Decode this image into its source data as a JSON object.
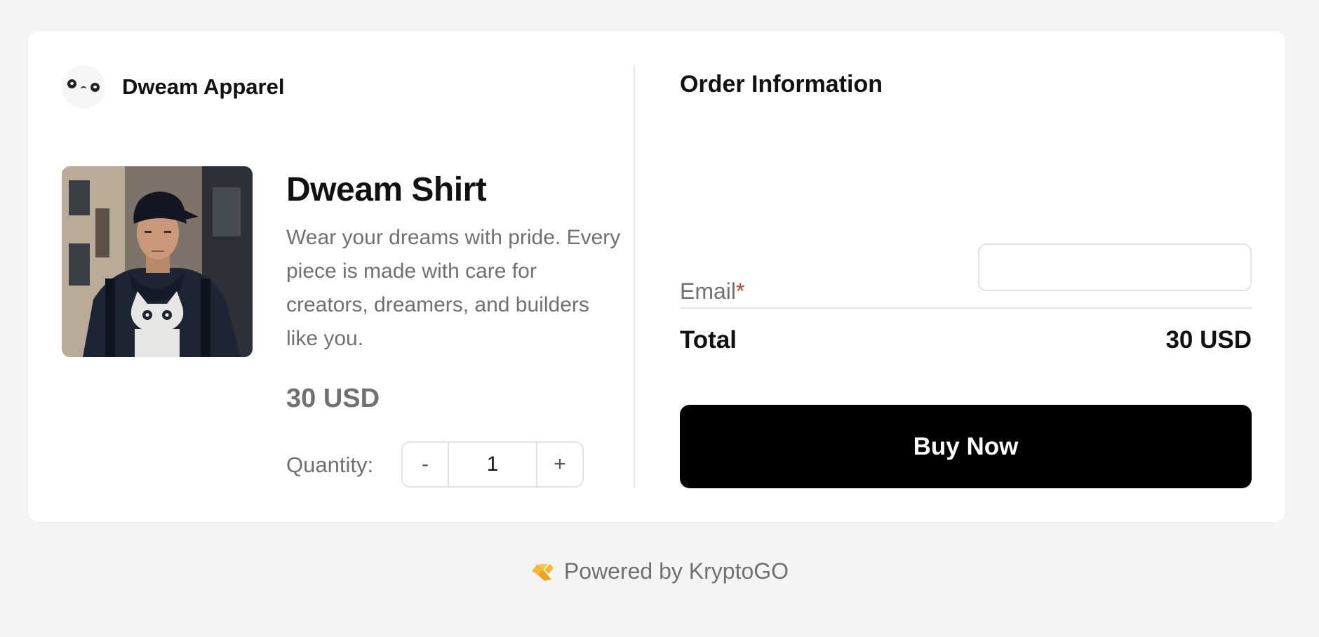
{
  "brand": {
    "name": "Dweam Apparel",
    "logo_icon": "panda-face-icon"
  },
  "product": {
    "title": "Dweam Shirt",
    "description": "Wear your dreams with pride. Every piece is made with care for creators, dreamers, and builders like you.",
    "price": "30 USD",
    "image_icon": "product-photo-icon",
    "quantity_label": "Quantity:",
    "decrement_label": "-",
    "increment_label": "+",
    "quantity_value": "1"
  },
  "order": {
    "title": "Order Information",
    "email_label": "Email",
    "email_required_mark": "*",
    "email_value": "",
    "total_label": "Total",
    "total_value": "30 USD",
    "buy_label": "Buy Now"
  },
  "footer": {
    "powered_by": "Powered by KryptoGO",
    "icon": "kryptogo-logo-icon",
    "icon_color": "#f5b82e"
  }
}
